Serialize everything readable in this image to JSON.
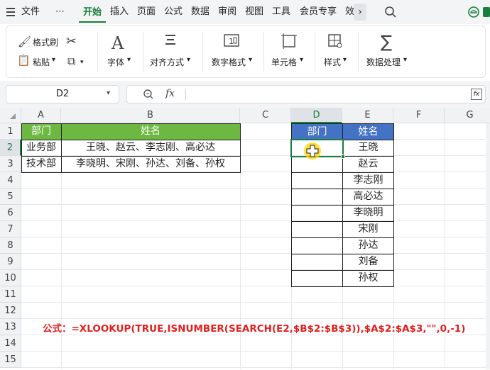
{
  "menu": {
    "file": "文件",
    "more": "⋯",
    "tabs": [
      "开始",
      "插入",
      "页面",
      "公式",
      "数据",
      "审阅",
      "视图",
      "工具",
      "会员专享",
      "效"
    ]
  },
  "ribbon": {
    "format_painter": "格式刷",
    "paste": "粘贴",
    "font": "字体",
    "align": "对齐方式",
    "number_format": "数字格式",
    "cells": "单元格",
    "styles": "样式",
    "data_processing": "数据处理"
  },
  "formula_bar": {
    "cell_ref": "D2",
    "fx": "fx",
    "formula": ""
  },
  "columns": [
    "A",
    "B",
    "C",
    "D",
    "E",
    "F",
    "G"
  ],
  "rows": [
    "1",
    "2",
    "3",
    "4",
    "5",
    "6",
    "7",
    "8",
    "9",
    "10",
    "11",
    "12",
    "13",
    "14",
    "15"
  ],
  "table1": {
    "header": [
      "部门",
      "姓名"
    ],
    "rows": [
      [
        "业务部",
        "王晓、赵云、李志刚、高必达"
      ],
      [
        "技术部",
        "李晓明、宋刚、孙达、刘备、孙权"
      ]
    ]
  },
  "table2": {
    "header": [
      "部门",
      "姓名"
    ],
    "names": [
      "王晓",
      "赵云",
      "李志刚",
      "高必达",
      "李晓明",
      "宋刚",
      "孙达",
      "刘备",
      "孙权"
    ]
  },
  "formula_note": "公式：=XLOOKUP(TRUE,ISNUMBER(SEARCH(E2,$B$2:$B$3)),$A$2:$A$3,\"\",0,-1)",
  "colors": {
    "header_green": "#6cb842",
    "header_blue": "#4472c4",
    "active_green": "#1a7f3c",
    "formula_red": "#e02020"
  }
}
